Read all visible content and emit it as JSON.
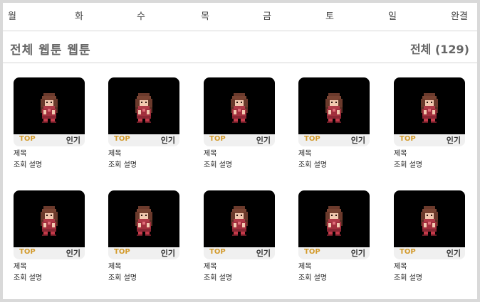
{
  "day_tabs": [
    "월",
    "화",
    "수",
    "목",
    "금",
    "토",
    "일",
    "완결"
  ],
  "section": {
    "title": "전체 웹툰 웹툰",
    "count_label": "전체 (129)"
  },
  "cards": [
    {
      "top": "TOP",
      "popular": "인기",
      "title": "제목",
      "desc": "조회 설명"
    },
    {
      "top": "TOP",
      "popular": "인기",
      "title": "제목",
      "desc": "조회 설명"
    },
    {
      "top": "TOP",
      "popular": "인기",
      "title": "제목",
      "desc": "조회 설명"
    },
    {
      "top": "TOP",
      "popular": "인기",
      "title": "제목",
      "desc": "조회 설명"
    },
    {
      "top": "TOP",
      "popular": "인기",
      "title": "제목",
      "desc": "조회 설명"
    },
    {
      "top": "TOP",
      "popular": "인기",
      "title": "제목",
      "desc": "조회 설명"
    },
    {
      "top": "TOP",
      "popular": "인기",
      "title": "제목",
      "desc": "조회 설명"
    },
    {
      "top": "TOP",
      "popular": "인기",
      "title": "제목",
      "desc": "조회 설명"
    },
    {
      "top": "TOP",
      "popular": "인기",
      "title": "제목",
      "desc": "조회 설명"
    },
    {
      "top": "TOP",
      "popular": "인기",
      "title": "제목",
      "desc": "조회 설명"
    }
  ],
  "colors": {
    "top_badge": "#d39a2a",
    "thumbnail_bg": "#000000",
    "badge_bar_bg": "#f0f0f0"
  }
}
